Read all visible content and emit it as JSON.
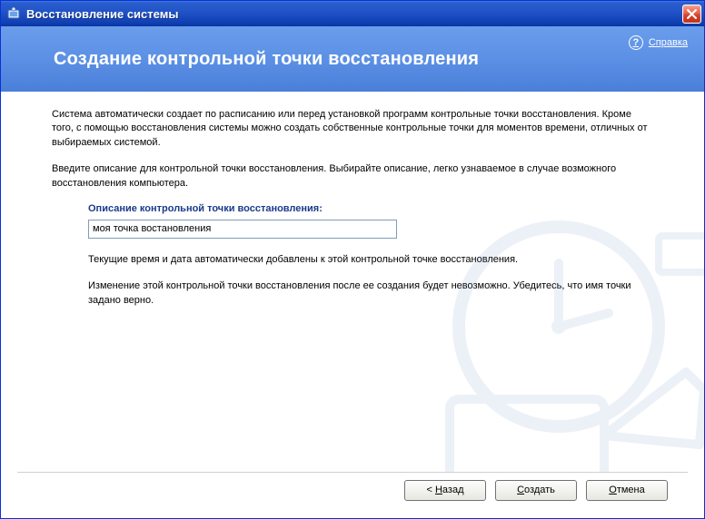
{
  "titlebar": {
    "title": "Восстановление системы"
  },
  "header": {
    "page_title": "Создание контрольной точки восстановления",
    "help_label": "Справка"
  },
  "content": {
    "intro": "Система автоматически создает по расписанию или перед установкой программ контрольные точки восстановления. Кроме того, с помощью восстановления системы можно создать собственные контрольные точки для моментов времени, отличных от выбираемых системой.",
    "instruction": "Введите описание для контрольной точки восстановления. Выбирайте описание, легко узнаваемое в случае возможного восстановления компьютера.",
    "field_label": "Описание контрольной точки восстановления:",
    "field_value": "моя точка востановления",
    "note1": "Текущие время и дата автоматически добавлены к этой контрольной точке восстановления.",
    "note2": "Изменение этой контрольной точки восстановления после ее создания будет невозможно. Убедитесь, что имя точки задано верно."
  },
  "footer": {
    "back_prefix": "< ",
    "back_underline": "Н",
    "back_rest": "азад",
    "create_underline": "С",
    "create_rest": "оздать",
    "cancel_underline": "О",
    "cancel_rest": "тмена"
  }
}
